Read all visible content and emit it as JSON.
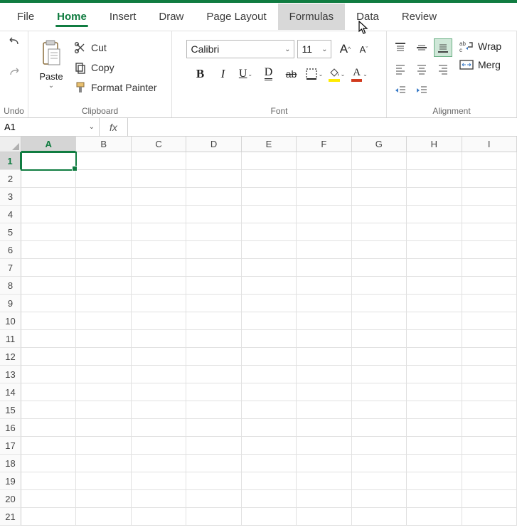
{
  "tabs": {
    "file": "File",
    "home": "Home",
    "insert": "Insert",
    "draw": "Draw",
    "page_layout": "Page Layout",
    "formulas": "Formulas",
    "data": "Data",
    "review": "Review",
    "active": "Home",
    "hovered": "Formulas"
  },
  "groups": {
    "undo": "Undo",
    "clipboard": "Clipboard",
    "font": "Font",
    "alignment": "Alignment"
  },
  "clipboard": {
    "paste": "Paste",
    "cut": "Cut",
    "copy": "Copy",
    "format_painter": "Format Painter"
  },
  "font": {
    "name": "Calibri",
    "size": "11",
    "grow_label": "A",
    "shrink_label": "A",
    "bold": "B",
    "italic": "I",
    "underline": "U",
    "dbl_underline": "D",
    "strike": "ab",
    "fontcolor_letter": "A",
    "highlight_icon": "fill",
    "border_icon": "border"
  },
  "align": {
    "wrap": "Wrap",
    "merge": "Merg"
  },
  "namebox": {
    "value": "A1"
  },
  "formula": {
    "fx": "fx",
    "value": ""
  },
  "grid": {
    "columns": [
      "A",
      "B",
      "C",
      "D",
      "E",
      "F",
      "G",
      "H",
      "I"
    ],
    "rows": [
      "1",
      "2",
      "3",
      "4",
      "5",
      "6",
      "7",
      "8",
      "9",
      "10",
      "11",
      "12",
      "13",
      "14",
      "15",
      "16",
      "17",
      "18",
      "19",
      "20",
      "21"
    ],
    "selected": {
      "col": "A",
      "row": "1"
    }
  }
}
